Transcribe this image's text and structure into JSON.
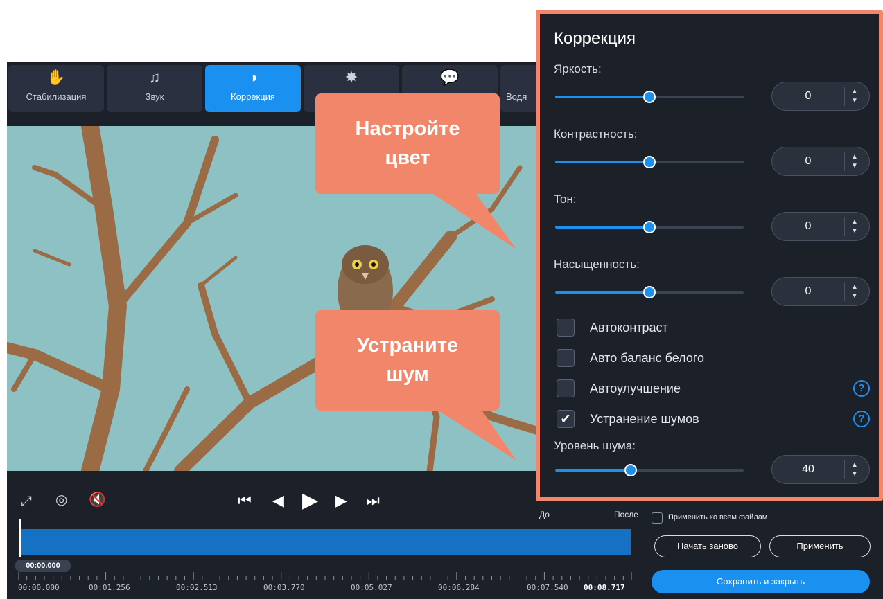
{
  "tabs": [
    {
      "label": "Стабилизация",
      "icon": "hand-stabilize-icon",
      "active": false
    },
    {
      "label": "Звук",
      "icon": "music-note-icon",
      "active": false
    },
    {
      "label": "Коррекция",
      "icon": "contrast-circle-icon",
      "active": true
    },
    {
      "label": "",
      "icon": "magic-wand-icon",
      "active": false
    },
    {
      "label": "",
      "icon": "speech-bubble-icon",
      "active": false
    },
    {
      "label": "Водя",
      "icon": "watermark-icon",
      "active": false
    }
  ],
  "player": {
    "compare_before": "До",
    "compare_after": "После",
    "current_time": "00:00.000"
  },
  "timeline": {
    "ticks": [
      "00:00.000",
      "00:01.256",
      "00:02.513",
      "00:03.770",
      "00:05.027",
      "00:06.284",
      "00:07.540"
    ],
    "duration": "00:08.717"
  },
  "actions": {
    "apply_all": "Применить ко всем файлам",
    "reset": "Начать заново",
    "apply": "Применить",
    "save_close": "Сохранить и закрыть"
  },
  "panel": {
    "title": "Коррекция",
    "sliders": [
      {
        "label": "Яркость:",
        "value": "0",
        "level": 0.5
      },
      {
        "label": "Контрастность:",
        "value": "0",
        "level": 0.5
      },
      {
        "label": "Тон:",
        "value": "0",
        "level": 0.5
      },
      {
        "label": "Насыщенность:",
        "value": "0",
        "level": 0.5
      }
    ],
    "checkboxes": [
      {
        "label": "Автоконтраст",
        "checked": false,
        "help": false
      },
      {
        "label": "Авто баланс белого",
        "checked": false,
        "help": false
      },
      {
        "label": "Автоулучшение",
        "checked": false,
        "help": true
      },
      {
        "label": "Устранение шумов",
        "checked": true,
        "help": true
      }
    ],
    "noise": {
      "label": "Уровень шума:",
      "value": "40",
      "level": 0.4
    }
  },
  "callouts": {
    "color": "Настройте цвет",
    "noise": "Устраните шум"
  },
  "colors": {
    "accent": "#1a90f0",
    "callout": "#f2866a",
    "panel_bg": "#1c2029",
    "sky": "#8ec1c4"
  }
}
